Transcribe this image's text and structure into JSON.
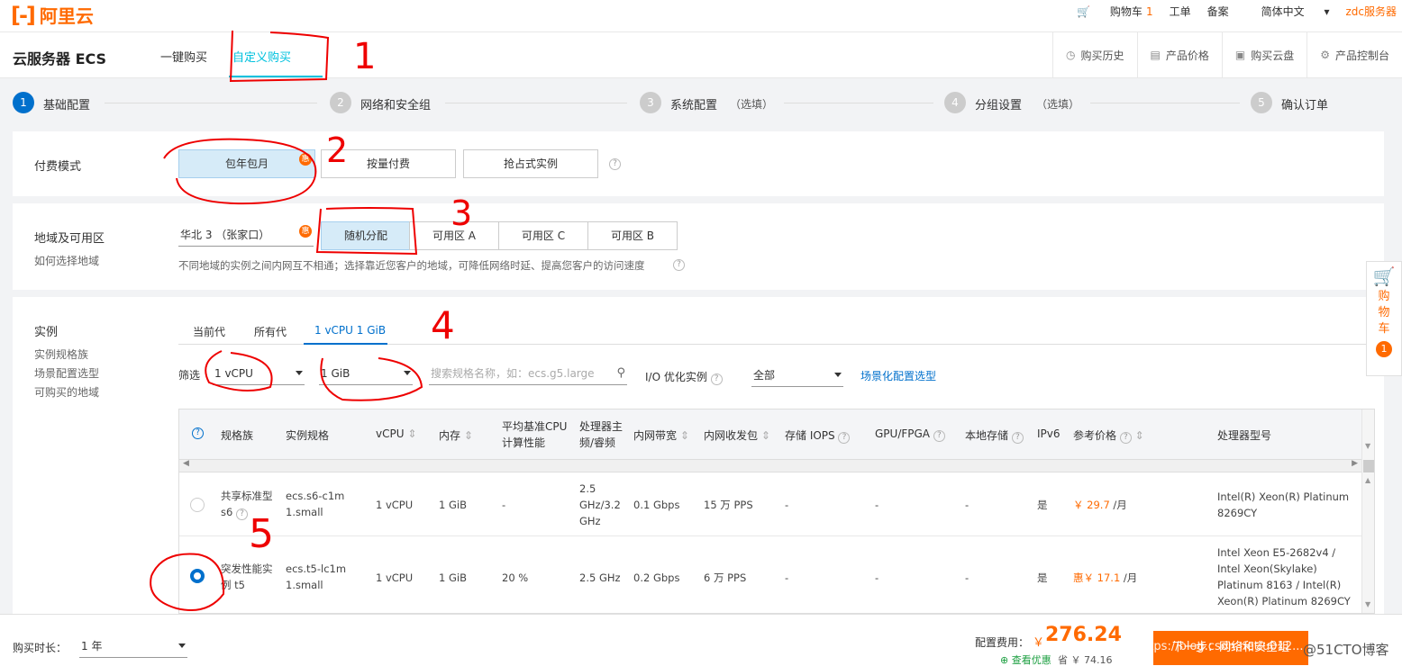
{
  "topbar": {
    "logo_mark": "[-]",
    "logo_text": "阿里云",
    "cart_label": "购物车",
    "cart_count": "1",
    "ticket": "工单",
    "beian": "备案",
    "lang": "简体中文",
    "user": "zdc服务器"
  },
  "header": {
    "title": "云服务器 ECS",
    "tab_quick": "一键购买",
    "tab_custom": "自定义购买",
    "history": "购买历史",
    "price": "产品价格",
    "buy_disk": "购买云盘",
    "console": "产品控制台"
  },
  "steps": [
    {
      "num": "1",
      "label": "基础配置",
      "opt": ""
    },
    {
      "num": "2",
      "label": "网络和安全组",
      "opt": ""
    },
    {
      "num": "3",
      "label": "系统配置",
      "opt": "（选填）"
    },
    {
      "num": "4",
      "label": "分组设置",
      "opt": "（选填）"
    },
    {
      "num": "5",
      "label": "确认订单",
      "opt": ""
    }
  ],
  "billing": {
    "label": "付费模式",
    "opt1": "包年包月",
    "opt2": "按量付费",
    "opt3": "抢占式实例",
    "badge": "惠"
  },
  "region": {
    "label": "地域及可用区",
    "help": "如何选择地域",
    "region_value": "华北 3 （张家口）",
    "zone_random": "随机分配",
    "zone_a": "可用区 A",
    "zone_c": "可用区 C",
    "zone_b": "可用区 B",
    "tip": "不同地域的实例之间内网互不相通；选择靠近您客户的地域，可降低网络时延、提高您客户的访问速度",
    "badge": "惠"
  },
  "instance": {
    "label": "实例",
    "side1": "实例规格族",
    "side2": "场景配置选型",
    "side3": "可购买的地域",
    "tab1": "当前代",
    "tab2": "所有代",
    "tab3": "1 vCPU 1 GiB",
    "filter_label": "筛选",
    "cpu": "1 vCPU",
    "mem": "1 GiB",
    "search_placeholder": "搜索规格名称，如：ecs.g5.large",
    "io_label": "I/O 优化实例",
    "io_value": "全部",
    "scene_link": "场景化配置选型"
  },
  "table": {
    "headers": {
      "family": "规格族",
      "spec": "实例规格",
      "vcpu": "vCPU",
      "mem": "内存",
      "baseline": "平均基准CPU计算性能",
      "freq": "处理器主频/睿频",
      "bandwidth": "内网带宽",
      "pps": "内网收发包",
      "iops": "存储 IOPS",
      "gpu": "GPU/FPGA",
      "local": "本地存储",
      "ipv6": "IPv6",
      "price": "参考价格",
      "cpu_model": "处理器型号"
    },
    "rows": [
      {
        "family": "共享标准型 s6",
        "spec": "ecs.s6-c1m1.small",
        "vcpu": "1 vCPU",
        "mem": "1 GiB",
        "baseline": "-",
        "freq": "2.5 GHz/3.2 GHz",
        "bandwidth": "0.1 Gbps",
        "pps": "15 万 PPS",
        "iops": "-",
        "gpu": "-",
        "local": "-",
        "ipv6": "是",
        "price_prefix": "",
        "price": "￥ 29.7",
        "unit": "/月",
        "cpu_model": "Intel(R) Xeon(R) Platinum 8269CY"
      },
      {
        "family": "突发性能实例 t5",
        "spec": "ecs.t5-lc1m1.small",
        "vcpu": "1 vCPU",
        "mem": "1 GiB",
        "baseline": "20 %",
        "freq": "2.5 GHz",
        "bandwidth": "0.2 Gbps",
        "pps": "6 万 PPS",
        "iops": "-",
        "gpu": "-",
        "local": "-",
        "ipv6": "是",
        "price_prefix": "惠",
        "price": "￥ 17.1",
        "unit": "/月",
        "cpu_model": "Intel Xeon E5-2682v4 / Intel Xeon(Skylake) Platinum 8163 / Intel(R) Xeon(R) Platinum 8269CY"
      }
    ]
  },
  "bottom": {
    "duration_label": "购买时长：",
    "duration_value": "1 年",
    "fee_label": "配置费用：",
    "currency": "￥",
    "fee": "276.24",
    "discount_link": "查看优惠",
    "save_label": "省 ￥ 74.16",
    "next_btn": "下一步：网络和安全组",
    "watermark": "https://blog.csdn.net/u012...",
    "watermark2": "@51CTO博客"
  },
  "cart_side": {
    "label": "购物车",
    "count": "1"
  },
  "annotations": [
    "1",
    "2",
    "3",
    "4",
    "5"
  ]
}
